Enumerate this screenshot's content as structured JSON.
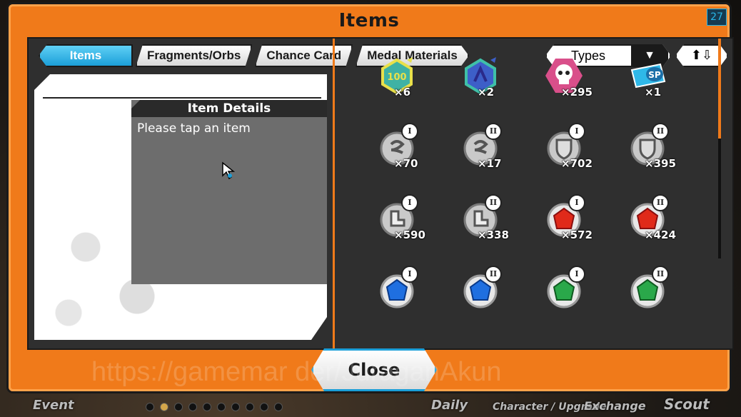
{
  "window": {
    "title": "Items",
    "counter": "27"
  },
  "tabs": [
    {
      "label": "Items",
      "active": true
    },
    {
      "label": "Fragments/Orbs"
    },
    {
      "label": "Chance Card"
    },
    {
      "label": "Medal Materials"
    }
  ],
  "filter": {
    "label": "Types",
    "arrow_icon": "▼"
  },
  "sort": {
    "icon": "⬆⇩"
  },
  "details": {
    "title": "Item Details",
    "text": "Please tap an item"
  },
  "items": [
    {
      "name": "ticket-100-hexagon",
      "qty": "×6"
    },
    {
      "name": "ticket-blue-hexagon",
      "qty": "×2"
    },
    {
      "name": "skull-pirate-token",
      "qty": "×295"
    },
    {
      "name": "sp-ticket",
      "qty": "×1"
    },
    {
      "name": "silver-orb-1",
      "badge": "I",
      "qty": "×70"
    },
    {
      "name": "silver-orb-2",
      "badge": "II",
      "qty": "×17"
    },
    {
      "name": "shield-orb-1",
      "badge": "I",
      "qty": "×702"
    },
    {
      "name": "shield-orb-2",
      "badge": "II",
      "qty": "×395"
    },
    {
      "name": "boot-orb-1",
      "badge": "I",
      "qty": "×590"
    },
    {
      "name": "boot-orb-2",
      "badge": "II",
      "qty": "×338"
    },
    {
      "name": "red-gem-1",
      "badge": "I",
      "qty": "×572"
    },
    {
      "name": "red-gem-2",
      "badge": "II",
      "qty": "×424"
    },
    {
      "name": "blue-gem-1",
      "badge": "I",
      "qty": ""
    },
    {
      "name": "blue-gem-2",
      "badge": "II",
      "qty": ""
    },
    {
      "name": "green-gem-1",
      "badge": "I",
      "qty": ""
    },
    {
      "name": "green-gem-2",
      "badge": "II",
      "qty": ""
    }
  ],
  "close_label": "Close",
  "watermark": "https://gamemar          der/JuraganAkun",
  "bottom_nav": [
    "Event",
    "Daily",
    "Character / Upgrade",
    "Exchange",
    "Scout"
  ],
  "colors": {
    "frame": "#f07a1a",
    "accent": "#1b9fd8"
  }
}
